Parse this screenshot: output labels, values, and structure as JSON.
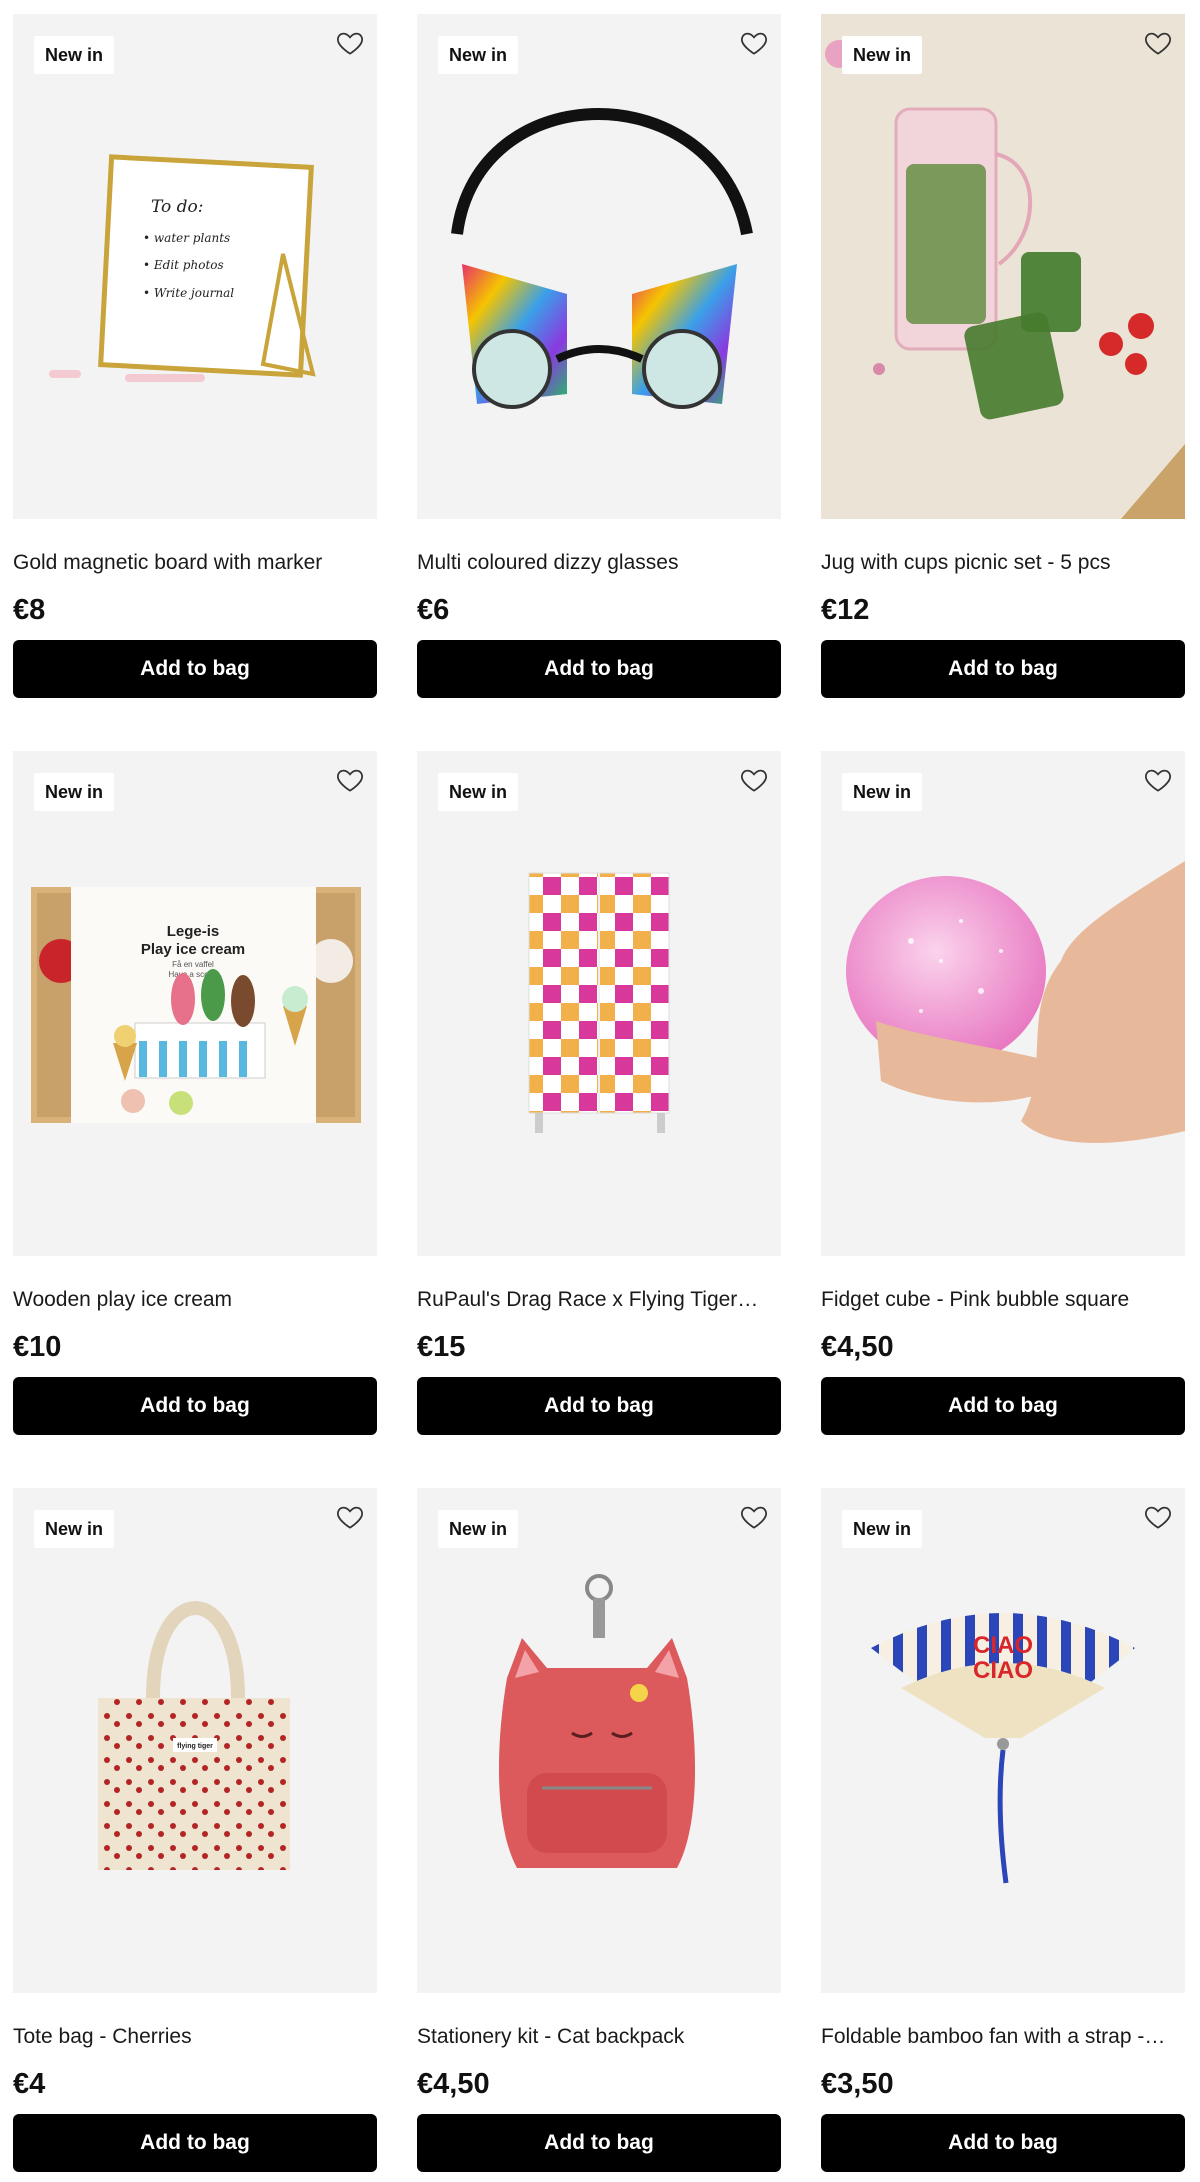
{
  "products": [
    {
      "badge": "New in",
      "title": "Gold magnetic board with marker",
      "price": "€8",
      "button": "Add to bag",
      "image": "gold-magnetic-board-image",
      "board_text": [
        "To do:",
        "• water plants",
        "• Edit photos",
        "• Write journal"
      ]
    },
    {
      "badge": "New in",
      "title": "Multi coloured dizzy glasses",
      "price": "€6",
      "button": "Add to bag",
      "image": "dizzy-glasses-image"
    },
    {
      "badge": "New in",
      "title": "Jug with cups picnic set - 5 pcs",
      "price": "€12",
      "button": "Add to bag",
      "image": "picnic-jug-image"
    },
    {
      "badge": "New in",
      "title": "Wooden play ice cream",
      "price": "€10",
      "button": "Add to bag",
      "image": "play-ice-cream-image",
      "box_text": [
        "Lege-is",
        "Play ice cream",
        "Få en vaffel",
        "Have a scoop"
      ]
    },
    {
      "badge": "New in",
      "title": "RuPaul's Drag Race x Flying Tiger…",
      "price": "€15",
      "button": "Add to bag",
      "image": "checkered-locker-image"
    },
    {
      "badge": "New in",
      "title": "Fidget cube - Pink bubble square",
      "price": "€4,50",
      "button": "Add to bag",
      "image": "pink-bubble-fidget-image"
    },
    {
      "badge": "New in",
      "title": "Tote bag - Cherries",
      "price": "€4",
      "button": "Add to bag",
      "image": "cherry-tote-bag-image",
      "bag_label": "flying tiger"
    },
    {
      "badge": "New in",
      "title": "Stationery kit - Cat backpack",
      "price": "€4,50",
      "button": "Add to bag",
      "image": "cat-backpack-image"
    },
    {
      "badge": "New in",
      "title": "Foldable bamboo fan with a strap -…",
      "price": "€3,50",
      "button": "Add to bag",
      "image": "bamboo-fan-image",
      "fan_text": [
        "CIAO",
        "CIAO"
      ]
    }
  ],
  "colors": {
    "button_bg": "#000000",
    "button_text": "#ffffff",
    "image_bg": "#f3f3f3",
    "badge_bg": "#ffffff"
  },
  "icons": {
    "wishlist": "heart-outline-icon"
  }
}
